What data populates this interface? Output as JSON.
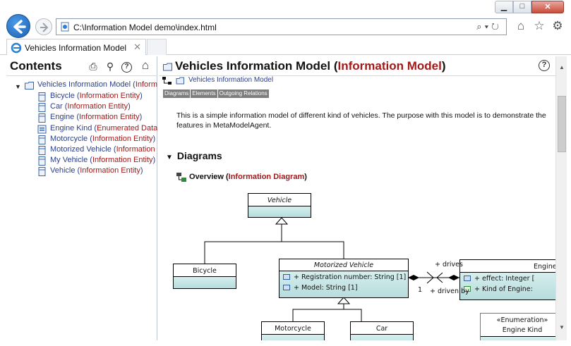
{
  "window": {
    "minimize": "▁",
    "maximize": "□",
    "close": "✕"
  },
  "address_bar": {
    "url": "C:\\Information Model demo\\index.html",
    "tools": "⌕▾↻"
  },
  "nav_icons": [
    "home-icon",
    "star-icon",
    "gear-icon"
  ],
  "tab": {
    "title": "Vehicles Information Model",
    "close": "✕"
  },
  "contents": {
    "title": "Contents",
    "tools": [
      "print-icon",
      "search-icon",
      "help-icon",
      "home-icon"
    ],
    "root": {
      "name": "Vehicles Information Model",
      "kind": "Information Model"
    },
    "items": [
      {
        "name": "Bicycle",
        "kind": "Information Entity",
        "icon": "entity"
      },
      {
        "name": "Car",
        "kind": "Information Entity",
        "icon": "entity"
      },
      {
        "name": "Engine",
        "kind": "Information Entity",
        "icon": "entity"
      },
      {
        "name": "Engine Kind",
        "kind": "Enumerated Data",
        "icon": "enum"
      },
      {
        "name": "Motorcycle",
        "kind": "Information Entity",
        "icon": "entity"
      },
      {
        "name": "Motorized Vehicle",
        "kind": "Information Entity",
        "icon": "entity"
      },
      {
        "name": "My Vehicle",
        "kind": "Information Entity",
        "icon": "entity"
      },
      {
        "name": "Vehicle",
        "kind": "Information Entity",
        "icon": "entity"
      }
    ]
  },
  "page": {
    "title": "Vehicles Information Model",
    "kind": "Information Model",
    "breadcrumb": "Vehicles Information Model",
    "section_tabs": [
      "Diagrams",
      "Elements",
      "Outgoing Relations"
    ],
    "description": "This is a simple information model of different kind of vehicles. The purpose with this model is to demonstrate the features in MetaModelAgent.",
    "diagrams_heading": "Diagrams",
    "diagram_link": {
      "name": "Overview",
      "kind": "Information Diagram"
    }
  },
  "diagram": {
    "classes": {
      "vehicle": "Vehicle",
      "bicycle": "Bicycle",
      "motorized": "Motorized Vehicle",
      "motorized_attrs": [
        "+ Registration number: String [1]",
        "+ Model: String [1]"
      ],
      "engine": "Engine",
      "engine_attrs": [
        "+ effect: Integer [",
        "+ Kind of Engine:"
      ],
      "motorcycle": "Motorcycle",
      "car": "Car",
      "enum_stereo": "«Enumeration»",
      "enum_name": "Engine Kind"
    },
    "labels": {
      "drives": "+ drives",
      "driven_by": "+ driven by",
      "mult_1": "1"
    }
  },
  "colors": {
    "link": "#2b3f8a",
    "kind": "#a01a1a",
    "class_fill": "#c6e6e6"
  }
}
